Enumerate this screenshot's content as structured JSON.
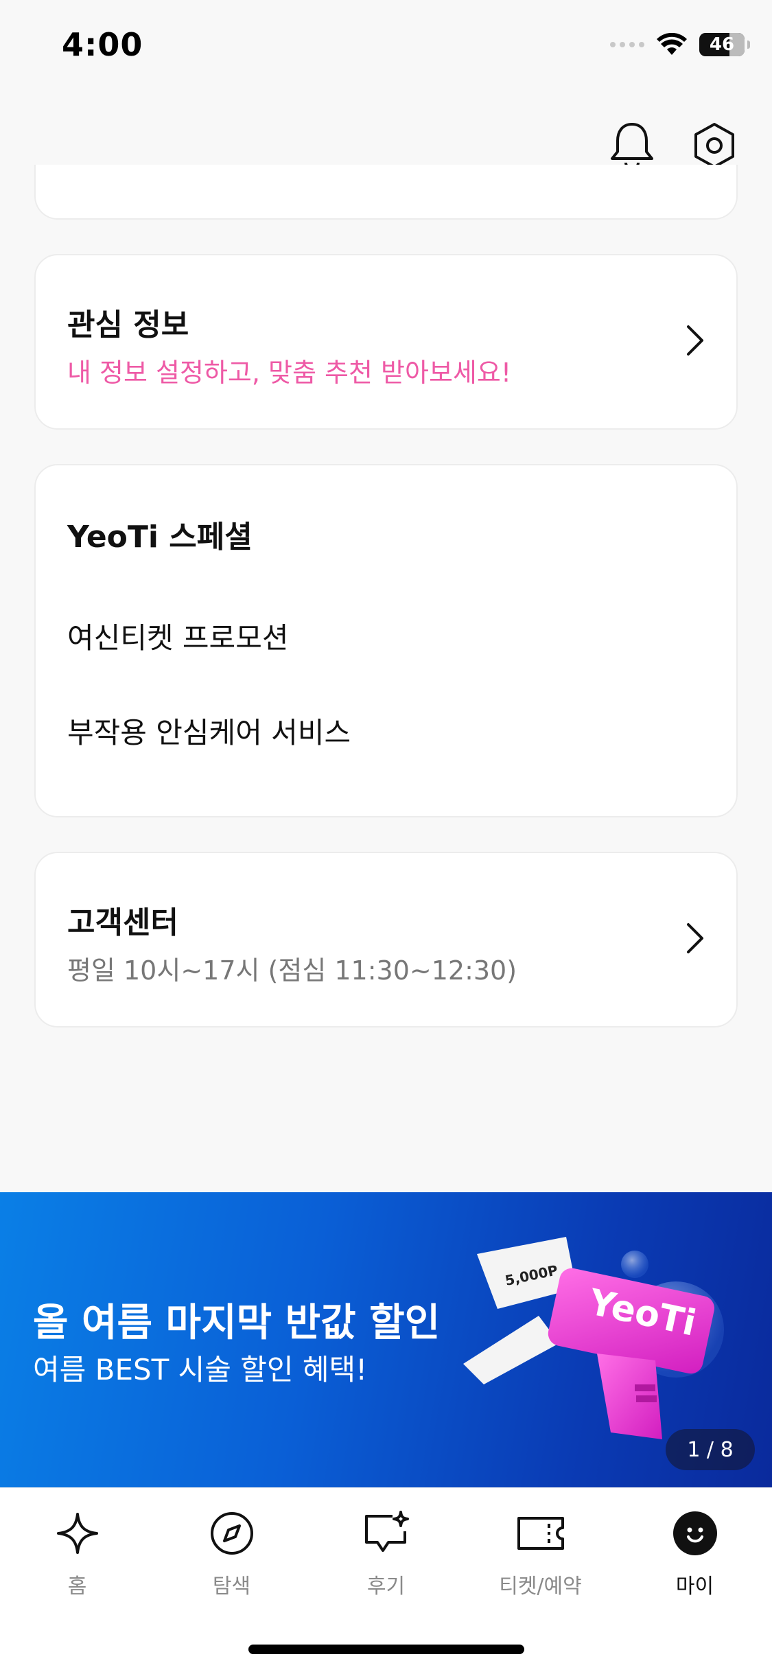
{
  "status_bar": {
    "time": "4:00",
    "battery": "46",
    "icons": [
      "signal-icon",
      "wifi-icon",
      "battery-icon"
    ]
  },
  "header": {
    "icons": [
      "bell-icon",
      "settings-hexagon-icon"
    ]
  },
  "interest_card": {
    "title": "관심 정보",
    "subtitle": "내 정보 설정하고, 맞춤 추천 받아보세요!",
    "subtitle_color": "#ee5aa6"
  },
  "special_card": {
    "title": "YeoTi 스페셜",
    "items": [
      {
        "label": "여신티켓 프로모션"
      },
      {
        "label": "부작용 안심케어 서비스"
      }
    ]
  },
  "support_card": {
    "title": "고객센터",
    "hours": "평일 10시~17시 (점심 11:30~12:30)"
  },
  "banner": {
    "title": "올 여름 마지막 반값 할인",
    "subtitle": "여름 BEST 시술 할인 혜택!",
    "page": "1 / 8",
    "art_brand": "YeoTi",
    "art_bill": "5,000P",
    "art_color": "#f23ad0"
  },
  "tabs": [
    {
      "label": "홈",
      "icon": "sparkle-icon",
      "active": false
    },
    {
      "label": "탐색",
      "icon": "compass-icon",
      "active": false
    },
    {
      "label": "후기",
      "icon": "review-chat-icon",
      "active": false
    },
    {
      "label": "티켓/예약",
      "icon": "ticket-icon",
      "active": false
    },
    {
      "label": "마이",
      "icon": "smiley-avatar-icon",
      "active": true
    }
  ],
  "colors": {
    "accent_pink": "#ee5aa6",
    "background": "#f8f8f8",
    "banner_blue": "#0a5fd6"
  }
}
